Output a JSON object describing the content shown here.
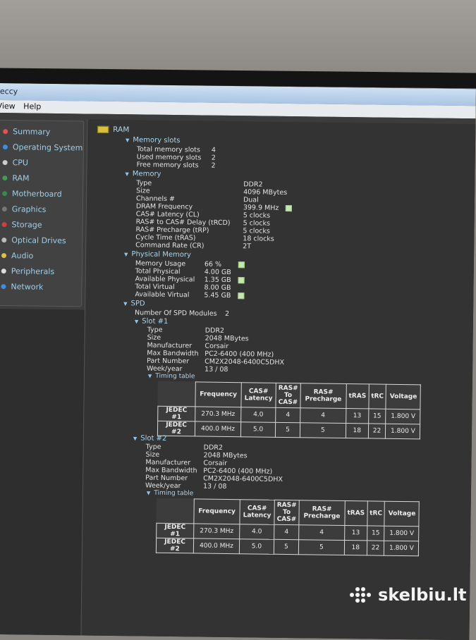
{
  "window": {
    "title": "eccy"
  },
  "menu": {
    "view": "View",
    "help": "Help"
  },
  "sidebar": {
    "items": [
      {
        "label": "Summary",
        "icon": "summary-icon",
        "color": "#e85050"
      },
      {
        "label": "Operating System",
        "icon": "os-icon",
        "color": "#3a8fe0"
      },
      {
        "label": "CPU",
        "icon": "cpu-icon",
        "color": "#cccccc"
      },
      {
        "label": "RAM",
        "icon": "ram-icon",
        "color": "#3aa04a"
      },
      {
        "label": "Motherboard",
        "icon": "motherboard-icon",
        "color": "#2f8f4a"
      },
      {
        "label": "Graphics",
        "icon": "graphics-icon",
        "color": "#777777"
      },
      {
        "label": "Storage",
        "icon": "storage-icon",
        "color": "#d04040"
      },
      {
        "label": "Optical Drives",
        "icon": "optical-drive-icon",
        "color": "#bbbbbb"
      },
      {
        "label": "Audio",
        "icon": "audio-icon",
        "color": "#e0c040"
      },
      {
        "label": "Peripherals",
        "icon": "peripherals-icon",
        "color": "#dddddd"
      },
      {
        "label": "Network",
        "icon": "network-icon",
        "color": "#3a8fe0"
      }
    ]
  },
  "ram": {
    "title": "RAM",
    "memory_slots": {
      "header": "Memory slots",
      "rows": [
        {
          "label": "Total memory slots",
          "value": "4"
        },
        {
          "label": "Used memory slots",
          "value": "2"
        },
        {
          "label": "Free memory slots",
          "value": "2"
        }
      ]
    },
    "memory": {
      "header": "Memory",
      "rows": [
        {
          "label": "Type",
          "value": "DDR2"
        },
        {
          "label": "Size",
          "value": "4096 MBytes"
        },
        {
          "label": "Channels #",
          "value": "Dual"
        },
        {
          "label": "DRAM Frequency",
          "value": "399.9 MHz"
        },
        {
          "label": "CAS# Latency (CL)",
          "value": "5 clocks"
        },
        {
          "label": "RAS# to CAS# Delay (tRCD)",
          "value": "5 clocks"
        },
        {
          "label": "RAS# Precharge (tRP)",
          "value": "5 clocks"
        },
        {
          "label": "Cycle Time (tRAS)",
          "value": "18 clocks"
        },
        {
          "label": "Command Rate (CR)",
          "value": "2T"
        }
      ]
    },
    "physical_memory": {
      "header": "Physical Memory",
      "rows": [
        {
          "label": "Memory Usage",
          "value": "66 %"
        },
        {
          "label": "Total Physical",
          "value": "4.00 GB"
        },
        {
          "label": "Available Physical",
          "value": "1.35 GB"
        },
        {
          "label": "Total Virtual",
          "value": "8.00 GB"
        },
        {
          "label": "Available Virtual",
          "value": "5.45 GB"
        }
      ]
    },
    "spd": {
      "header": "SPD",
      "modules_label": "Number Of SPD Modules",
      "modules_value": "2",
      "timing_header": "Timing table",
      "columns": [
        "Frequency",
        "CAS# Latency",
        "RAS# To CAS#",
        "RAS# Precharge",
        "tRAS",
        "tRC",
        "Voltage"
      ],
      "slots": [
        {
          "header": "Slot #1",
          "rows": [
            {
              "label": "Type",
              "value": "DDR2"
            },
            {
              "label": "Size",
              "value": "2048 MBytes"
            },
            {
              "label": "Manufacturer",
              "value": "Corsair"
            },
            {
              "label": "Max Bandwidth",
              "value": "PC2-6400 (400 MHz)"
            },
            {
              "label": "Part Number",
              "value": "CM2X2048-6400C5DHX"
            },
            {
              "label": "Week/year",
              "value": "13 / 08"
            }
          ],
          "timing": [
            {
              "name": "JEDEC #1",
              "cells": [
                "270.3 MHz",
                "4.0",
                "4",
                "4",
                "13",
                "15",
                "1.800 V"
              ]
            },
            {
              "name": "JEDEC #2",
              "cells": [
                "400.0 MHz",
                "5.0",
                "5",
                "5",
                "18",
                "22",
                "1.800 V"
              ]
            }
          ]
        },
        {
          "header": "Slot #2",
          "rows": [
            {
              "label": "Type",
              "value": "DDR2"
            },
            {
              "label": "Size",
              "value": "2048 MBytes"
            },
            {
              "label": "Manufacturer",
              "value": "Corsair"
            },
            {
              "label": "Max Bandwidth",
              "value": "PC2-6400 (400 MHz)"
            },
            {
              "label": "Part Number",
              "value": "CM2X2048-6400C5DHX"
            },
            {
              "label": "Week/year",
              "value": "13 / 08"
            }
          ],
          "timing": [
            {
              "name": "JEDEC #1",
              "cells": [
                "270.3 MHz",
                "4.0",
                "4",
                "4",
                "13",
                "15",
                "1.800 V"
              ]
            },
            {
              "name": "JEDEC #2",
              "cells": [
                "400.0 MHz",
                "5.0",
                "5",
                "5",
                "18",
                "22",
                "1.800 V"
              ]
            }
          ]
        }
      ]
    }
  },
  "watermark": {
    "text": "skelbiu.lt"
  }
}
